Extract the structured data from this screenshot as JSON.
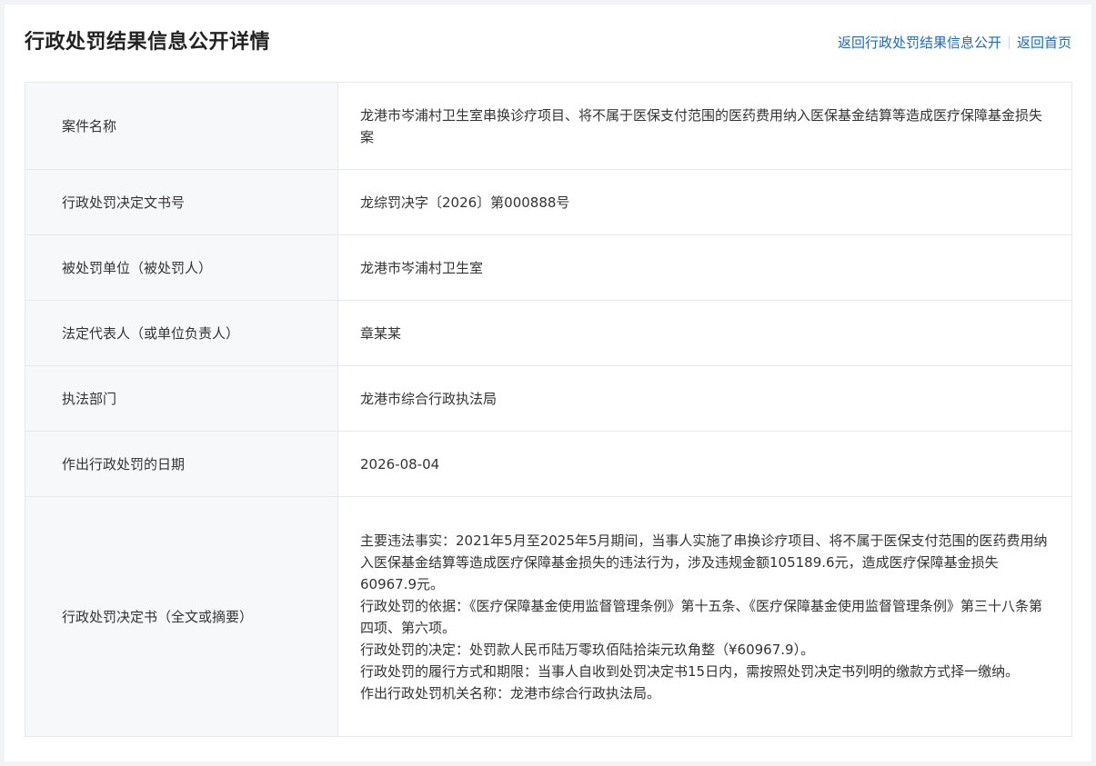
{
  "header": {
    "title": "行政处罚结果信息公开详情",
    "links": {
      "back_to_list": "返回行政处罚结果信息公开",
      "back_home": "返回首页"
    }
  },
  "details": {
    "rows": [
      {
        "label": "案件名称",
        "value": "龙港市岑浦村卫生室串换诊疗项目、将不属于医保支付范围的医药费用纳入医保基金结算等造成医疗保障基金损失案"
      },
      {
        "label": "行政处罚决定文书号",
        "value": "龙综罚决字〔2026〕第000888号"
      },
      {
        "label": "被处罚单位（被处罚人）",
        "value": "龙港市岑浦村卫生室"
      },
      {
        "label": "法定代表人（或单位负责人）",
        "value": "章某某"
      },
      {
        "label": "执法部门",
        "value": "龙港市综合行政执法局"
      },
      {
        "label": "作出行政处罚的日期",
        "value": "2026-08-04"
      },
      {
        "label": "行政处罚决定书（全文或摘要）"
      }
    ],
    "summary": [
      "主要违法事实：2021年5月至2025年5月期间，当事人实施了串换诊疗项目、将不属于医保支付范围的医药费用纳入医保基金结算等造成医疗保障基金损失的违法行为，涉及违规金额105189.6元，造成医疗保障基金损失60967.9元。",
      "行政处罚的依据：《医疗保障基金使用监督管理条例》第十五条、《医疗保障基金使用监督管理条例》第三十八条第四项、第六项。",
      "行政处罚的决定：处罚款人民币陆万零玖佰陆拾柒元玖角整（¥60967.9）。",
      "行政处罚的履行方式和期限：当事人自收到处罚决定书15日内，需按照处罚决定书列明的缴款方式择一缴纳。",
      "作出行政处罚机关名称：龙港市综合行政执法局。"
    ]
  },
  "colors": {
    "link": "#1e6bbf",
    "label_background": "#f7f8fa",
    "border": "#e6e8eb",
    "page_background": "#f2f3f5"
  }
}
